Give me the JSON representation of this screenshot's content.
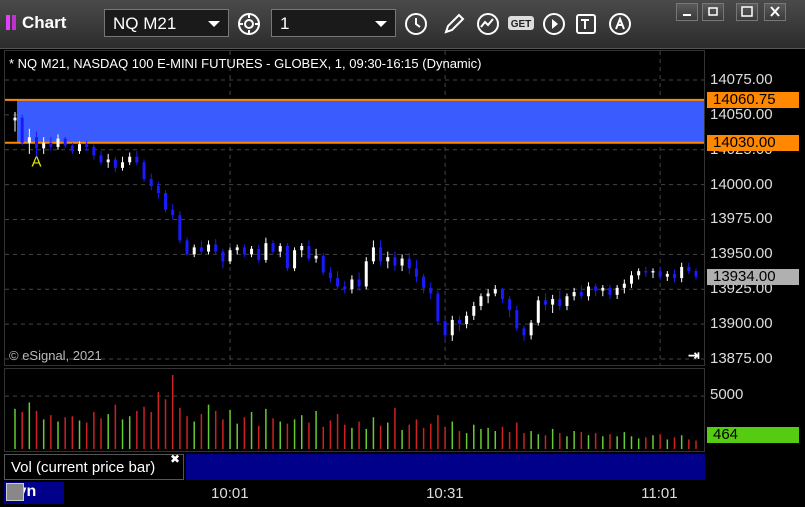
{
  "window": {
    "title": "Chart",
    "symbol": "NQ M21",
    "interval": "1"
  },
  "pane": {
    "title": "* NQ M21, NASDAQ 100 E-MINI FUTURES - GLOBEX, 1, 09:30-16:15 (Dynamic)",
    "copyright": "© eSignal, 2021",
    "volume_label": "Vol (current price bar)",
    "mode": "Dyn"
  },
  "colors": {
    "bull": "#ffffff",
    "bear": "#1a1aff",
    "zone": "#3a5cff",
    "zone_line": "#ff8800",
    "vol_up": "#66cc33",
    "vol_down": "#cc2222",
    "last_tag": "#b0b0b0",
    "vol_tag": "#55cc11"
  },
  "chart_data": {
    "type": "candlestick",
    "y_ticks": [
      "14075.00",
      "14050.00",
      "14025.00",
      "14000.00",
      "13975.00",
      "13950.00",
      "13925.00",
      "13900.00",
      "13875.00"
    ],
    "ylim": [
      13870,
      14085
    ],
    "x_ticks": [
      "10:01",
      "10:31",
      "11:01"
    ],
    "x_tick_bar_index": [
      30,
      60,
      90
    ],
    "zone": {
      "upper": 14060.75,
      "lower": 14030.0,
      "upper_label": "14060.75",
      "lower_label": "14030.00",
      "marker": "A"
    },
    "last_price": {
      "value": 13934.0,
      "label": "13934.00"
    },
    "volume": {
      "tick_label": "5000",
      "tick_value": 5000,
      "vmax": 7000,
      "last_label": "464",
      "last_value": 464
    },
    "ohlc": [
      [
        14046,
        14052,
        14038,
        14048
      ],
      [
        14048,
        14050,
        14028,
        14030
      ],
      [
        14030,
        14040,
        14022,
        14034
      ],
      [
        14034,
        14038,
        14020,
        14026
      ],
      [
        14026,
        14034,
        14022,
        14030
      ],
      [
        14030,
        14034,
        14024,
        14027
      ],
      [
        14027,
        14036,
        14025,
        14033
      ],
      [
        14033,
        14034,
        14026,
        14028
      ],
      [
        14028,
        14030,
        14022,
        14024
      ],
      [
        14024,
        14031,
        14022,
        14029
      ],
      [
        14029,
        14031,
        14024,
        14027
      ],
      [
        14027,
        14029,
        14018,
        14021
      ],
      [
        14021,
        14024,
        14014,
        14016
      ],
      [
        14016,
        14022,
        14012,
        14018
      ],
      [
        14018,
        14020,
        14009,
        14012
      ],
      [
        14012,
        14020,
        14010,
        14016
      ],
      [
        14016,
        14023,
        14014,
        14020
      ],
      [
        14020,
        14024,
        14014,
        14016
      ],
      [
        14016,
        14018,
        14002,
        14004
      ],
      [
        14004,
        14008,
        13996,
        13999
      ],
      [
        13999,
        14002,
        13990,
        13994
      ],
      [
        13994,
        13996,
        13980,
        13982
      ],
      [
        13982,
        13986,
        13975,
        13978
      ],
      [
        13978,
        13981,
        13958,
        13960
      ],
      [
        13960,
        13962,
        13949,
        13950
      ],
      [
        13950,
        13957,
        13948,
        13955
      ],
      [
        13955,
        13960,
        13950,
        13952
      ],
      [
        13952,
        13960,
        13950,
        13957
      ],
      [
        13957,
        13961,
        13950,
        13952
      ],
      [
        13952,
        13954,
        13940,
        13945
      ],
      [
        13945,
        13955,
        13943,
        13953
      ],
      [
        13953,
        13957,
        13950,
        13955
      ],
      [
        13955,
        13957,
        13948,
        13950
      ],
      [
        13950,
        13956,
        13948,
        13954
      ],
      [
        13954,
        13957,
        13944,
        13946
      ],
      [
        13946,
        13962,
        13944,
        13958
      ],
      [
        13958,
        13960,
        13950,
        13952
      ],
      [
        13952,
        13958,
        13948,
        13956
      ],
      [
        13956,
        13958,
        13938,
        13940
      ],
      [
        13940,
        13955,
        13938,
        13953
      ],
      [
        13953,
        13958,
        13948,
        13956
      ],
      [
        13956,
        13960,
        13945,
        13947
      ],
      [
        13947,
        13954,
        13944,
        13949
      ],
      [
        13949,
        13951,
        13935,
        13937
      ],
      [
        13937,
        13941,
        13930,
        13933
      ],
      [
        13933,
        13938,
        13925,
        13927
      ],
      [
        13927,
        13931,
        13922,
        13925
      ],
      [
        13925,
        13935,
        13922,
        13932
      ],
      [
        13932,
        13937,
        13924,
        13927
      ],
      [
        13927,
        13948,
        13925,
        13945
      ],
      [
        13945,
        13960,
        13943,
        13955
      ],
      [
        13955,
        13960,
        13942,
        13945
      ],
      [
        13945,
        13952,
        13940,
        13948
      ],
      [
        13948,
        13952,
        13938,
        13942
      ],
      [
        13942,
        13950,
        13938,
        13947
      ],
      [
        13947,
        13951,
        13936,
        13940
      ],
      [
        13940,
        13946,
        13930,
        13934
      ],
      [
        13934,
        13936,
        13922,
        13926
      ],
      [
        13926,
        13930,
        13918,
        13922
      ],
      [
        13922,
        13924,
        13900,
        13902
      ],
      [
        13902,
        13904,
        13888,
        13892
      ],
      [
        13892,
        13906,
        13888,
        13903
      ],
      [
        13903,
        13906,
        13895,
        13900
      ],
      [
        13900,
        13909,
        13897,
        13906
      ],
      [
        13906,
        13916,
        13903,
        13913
      ],
      [
        13913,
        13922,
        13910,
        13920
      ],
      [
        13920,
        13925,
        13915,
        13922
      ],
      [
        13922,
        13928,
        13920,
        13925
      ],
      [
        13925,
        13926,
        13915,
        13918
      ],
      [
        13918,
        13920,
        13905,
        13910
      ],
      [
        13910,
        13913,
        13895,
        13897
      ],
      [
        13897,
        13899,
        13888,
        13892
      ],
      [
        13892,
        13903,
        13889,
        13901
      ],
      [
        13901,
        13920,
        13899,
        13917
      ],
      [
        13917,
        13922,
        13910,
        13914
      ],
      [
        13914,
        13921,
        13908,
        13918
      ],
      [
        13918,
        13924,
        13910,
        13913
      ],
      [
        13913,
        13922,
        13910,
        13920
      ],
      [
        13920,
        13926,
        13917,
        13923
      ],
      [
        13923,
        13928,
        13918,
        13920
      ],
      [
        13920,
        13930,
        13917,
        13927
      ],
      [
        13927,
        13929,
        13920,
        13924
      ],
      [
        13924,
        13928,
        13920,
        13926
      ],
      [
        13926,
        13928,
        13918,
        13921
      ],
      [
        13921,
        13928,
        13918,
        13926
      ],
      [
        13926,
        13932,
        13922,
        13929
      ],
      [
        13929,
        13938,
        13926,
        13935
      ],
      [
        13935,
        13940,
        13932,
        13938
      ],
      [
        13938,
        13941,
        13934,
        13937
      ],
      [
        13937,
        13940,
        13933,
        13938
      ],
      [
        13938,
        13941,
        13932,
        13934
      ],
      [
        13934,
        13938,
        13931,
        13936
      ],
      [
        13936,
        13939,
        13930,
        13933
      ],
      [
        13933,
        13944,
        13930,
        13941
      ],
      [
        13941,
        13944,
        13936,
        13938
      ],
      [
        13938,
        13940,
        13932,
        13934
      ]
    ],
    "volumes": [
      3800,
      3500,
      4400,
      3600,
      2800,
      3200,
      2600,
      3000,
      3100,
      2700,
      2500,
      3500,
      2900,
      3300,
      4200,
      2800,
      3100,
      3600,
      4000,
      3500,
      5400,
      4700,
      7000,
      3900,
      3100,
      2600,
      3300,
      4200,
      3600,
      2800,
      3700,
      2400,
      3000,
      3500,
      2200,
      3800,
      2900,
      2600,
      2400,
      2800,
      3200,
      2500,
      3600,
      2100,
      2700,
      3300,
      2300,
      2000,
      2600,
      1900,
      3000,
      2200,
      2500,
      3900,
      1800,
      2300,
      2800,
      2000,
      2400,
      3200,
      2100,
      2600,
      1700,
      1500,
      2300,
      1900,
      2000,
      1700,
      2100,
      1600,
      2500,
      1500,
      1700,
      1400,
      1300,
      1900,
      1500,
      1200,
      1700,
      1600,
      1300,
      1500,
      1200,
      1400,
      1200,
      1600,
      1200,
      1000,
      1100,
      1300,
      1400,
      900,
      1100,
      1300,
      900,
      800
    ]
  }
}
